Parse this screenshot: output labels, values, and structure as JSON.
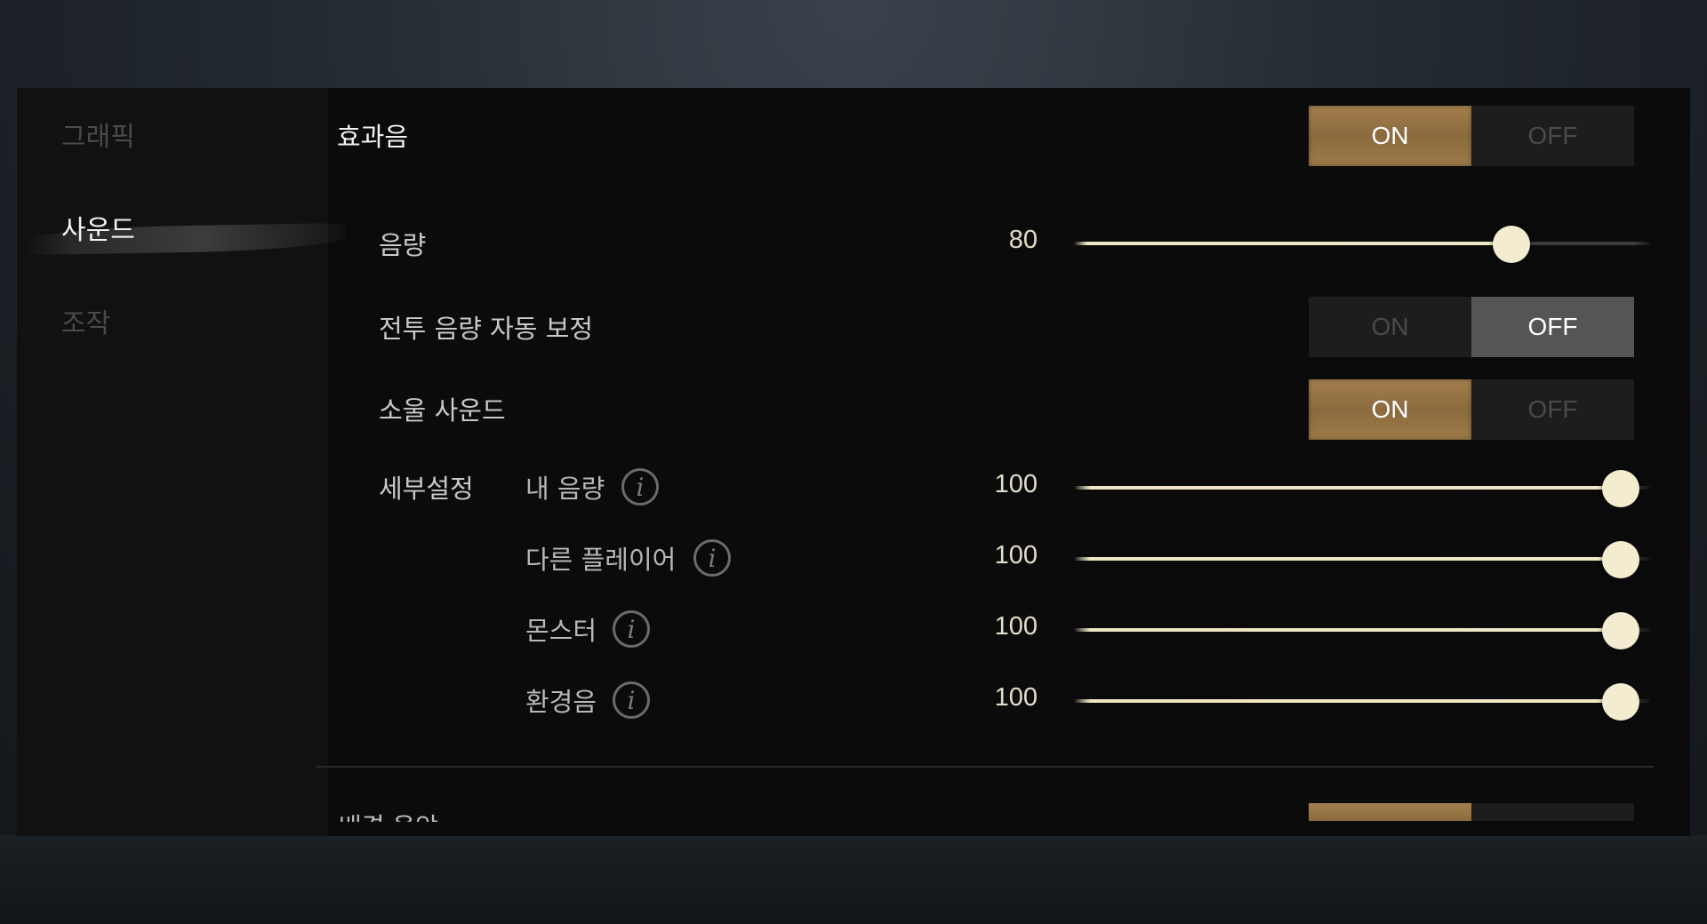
{
  "sidebar": {
    "items": [
      {
        "label": "그래픽"
      },
      {
        "label": "사운드"
      },
      {
        "label": "조작"
      }
    ]
  },
  "sound": {
    "effects": {
      "label": "효과음",
      "on": "ON",
      "off": "OFF",
      "selected": "ON"
    },
    "volume": {
      "label": "음량",
      "value": "80",
      "level": 80
    },
    "battle_auto": {
      "label": "전투 음량 자동 보정",
      "on": "ON",
      "off": "OFF",
      "selected": "OFF"
    },
    "soul_sound": {
      "label": "소울 사운드",
      "on": "ON",
      "off": "OFF",
      "selected": "ON"
    },
    "detail": {
      "label": "세부설정",
      "items": [
        {
          "label": "내 음량",
          "value": "100",
          "level": 100
        },
        {
          "label": "다른 플레이어",
          "value": "100",
          "level": 100
        },
        {
          "label": "몬스터",
          "value": "100",
          "level": 100
        },
        {
          "label": "환경음",
          "value": "100",
          "level": 100
        }
      ]
    }
  },
  "next_section": {
    "label": "배경 음악"
  },
  "colors": {
    "accent_on": "#9a7646",
    "off_selected": "#555555",
    "slider_fill": "#efe6c6",
    "panel_bg": "#0b0b0b"
  },
  "icons": {
    "info": "info-icon"
  }
}
